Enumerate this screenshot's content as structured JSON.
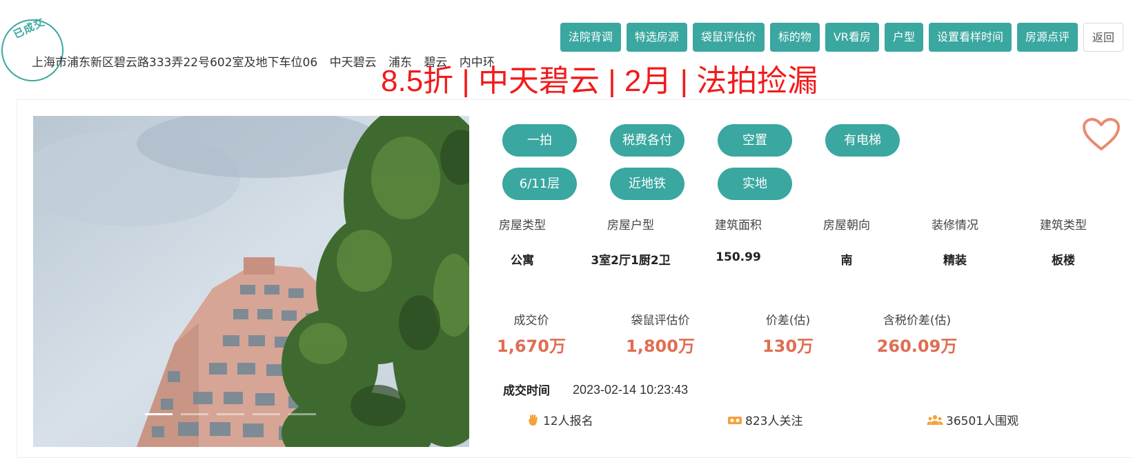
{
  "stamp": {
    "text": "已成交",
    "color": "#3aa7a0"
  },
  "address": {
    "full": "上海市浦东新区碧云路333弄22号602室及地下车位06",
    "community": "中天碧云",
    "district": "浦东",
    "area": "碧云",
    "ring": "内中环"
  },
  "nav": {
    "items": [
      "法院背调",
      "特选房源",
      "袋鼠评估价",
      "标的物",
      "VR看房",
      "户型",
      "设置看样时间",
      "房源点评"
    ],
    "back_label": "返回"
  },
  "headline": "8.5折 | 中天碧云 | 2月 | 法拍捡漏",
  "tags": {
    "row1": [
      "一拍",
      "税费各付",
      "空置",
      "有电梯"
    ],
    "row2": [
      "6/11层",
      "近地铁",
      "实地"
    ]
  },
  "attributes": [
    {
      "label": "房屋类型",
      "value": "公寓"
    },
    {
      "label": "房屋户型",
      "value": "3室2厅1厨2卫"
    },
    {
      "label": "建筑面积",
      "value": "150.99"
    },
    {
      "label": "房屋朝向",
      "value": "南"
    },
    {
      "label": "装修情况",
      "value": "精装"
    },
    {
      "label": "建筑类型",
      "value": "板楼"
    }
  ],
  "prices": [
    {
      "label": "成交价",
      "value": "1,670万"
    },
    {
      "label": "袋鼠评估价",
      "value": "1,800万"
    },
    {
      "label": "价差(估)",
      "value": "130万"
    },
    {
      "label": "含税价差(估)",
      "value": "260.09万"
    }
  ],
  "deal_time": {
    "label": "成交时间",
    "value": "2023-02-14 10:23:43"
  },
  "stats": {
    "signup": "12人报名",
    "follow": "823人关注",
    "watch": "36501人围观"
  },
  "colors": {
    "accent": "#3aa7a0",
    "headline": "#f21a1a",
    "price": "#e06d52",
    "icon": "#f2a33a"
  }
}
